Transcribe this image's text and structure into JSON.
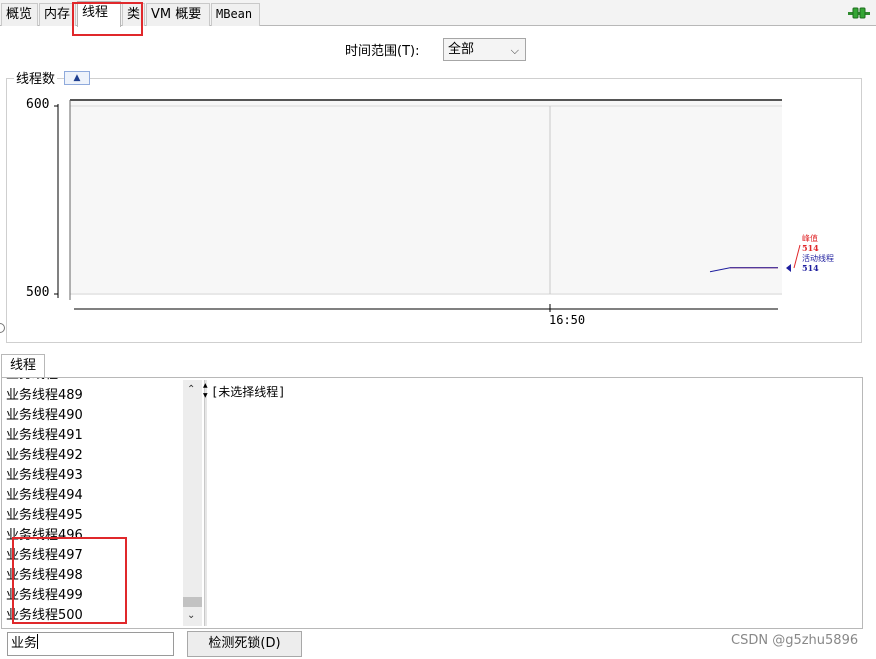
{
  "tabs": [
    {
      "label": "概览",
      "active": false
    },
    {
      "label": "内存",
      "active": false
    },
    {
      "label": "线程",
      "active": true
    },
    {
      "label": "类",
      "active": false
    },
    {
      "label": "VM 概要",
      "active": false
    },
    {
      "label": "MBean",
      "active": false
    }
  ],
  "time_range": {
    "label": "时间范围(T):",
    "selected": "全部"
  },
  "threads_panel": {
    "title": "线程数",
    "chart_data": {
      "type": "line",
      "ylim": [
        500,
        600
      ],
      "yticks": [
        "600",
        "500"
      ],
      "xticks": [
        "16:50"
      ],
      "series": [
        {
          "name": "峰值",
          "color": "#e0282b",
          "last_value": 514
        },
        {
          "name": "活动线程",
          "color": "#1f1f9f",
          "last_value": 514
        }
      ],
      "legend": {
        "peak_label": "峰值",
        "peak_value": "514",
        "live_label": "活动线程",
        "live_value": "514"
      }
    }
  },
  "lower": {
    "tab_label": "线程",
    "threads": [
      "业务线程489",
      "业务线程490",
      "业务线程491",
      "业务线程492",
      "业务线程493",
      "业务线程494",
      "业务线程495",
      "业务线程496",
      "业务线程497",
      "业务线程498",
      "业务线程499",
      "业务线程500"
    ],
    "details": "[未选择线程]",
    "filter_value": "业务",
    "deadlock_button": "检测死锁(D)"
  },
  "watermark": "CSDN @g5zhu5896",
  "colors": {
    "highlight": "#e0282b",
    "accent": "#1f1f9f"
  }
}
